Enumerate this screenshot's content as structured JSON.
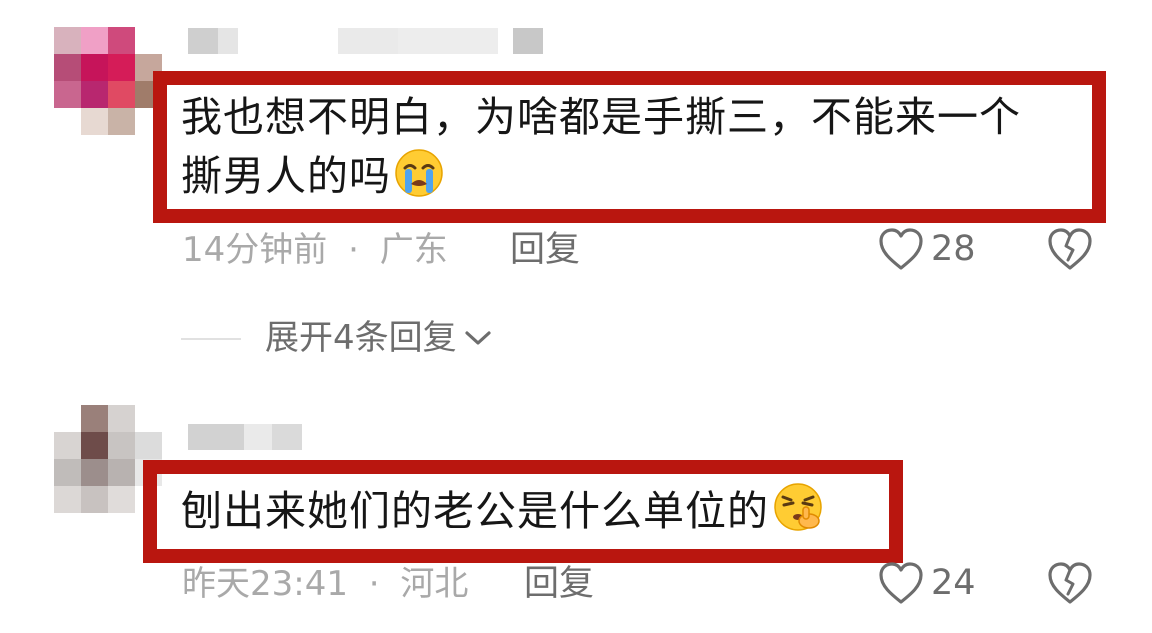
{
  "comments": [
    {
      "text_line1": "我也想不明白，为啥都是手撕三，不能来一个",
      "text_line2": "撕男人的吗",
      "emoji": "crying-face-emoji",
      "time": "14分钟前",
      "separator": "·",
      "location": "广东",
      "reply_label": "回复",
      "likes": "28",
      "expand_label": "展开4条回复"
    },
    {
      "text_line1": "刨出来她们的老公是什么单位的",
      "emoji": "shushing-face-emoji",
      "time": "昨天23:41",
      "separator": "·",
      "location": "河北",
      "reply_label": "回复",
      "likes": "24"
    }
  ],
  "colors": {
    "highlight_border": "#b9160f",
    "meta_text": "#a9a9a9",
    "action_text": "#6d6d6d"
  },
  "icons": [
    "heart-outline-icon",
    "broken-heart-icon",
    "chevron-down-icon"
  ]
}
